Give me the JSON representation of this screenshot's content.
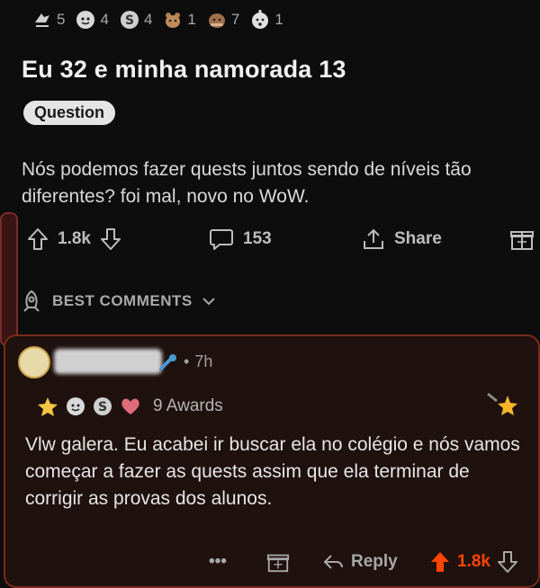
{
  "post_awards": [
    {
      "icon": "helpful-award-icon",
      "count": "5"
    },
    {
      "icon": "wholesome-award-icon",
      "count": "4"
    },
    {
      "icon": "silver-award-icon",
      "count": "4"
    },
    {
      "icon": "bear-award-icon",
      "count": "1"
    },
    {
      "icon": "hug-award-icon",
      "count": "7"
    },
    {
      "icon": "wow-award-icon",
      "count": "1"
    }
  ],
  "post": {
    "title": "Eu 32 e minha namorada 13",
    "flair": "Question",
    "body": "Nós podemos fazer quests juntos sendo de níveis tão diferentes? foi mal, novo no WoW.",
    "upvotes": "1.8k",
    "comments": "153",
    "share_label": "Share"
  },
  "comments_sort": {
    "label": "BEST COMMENTS"
  },
  "comment": {
    "time": "7h",
    "awards_label": "9 Awards",
    "body": "Vlw galera. Eu acabei ir buscar ela no colégio e nós vamos começar a fazer as quests assim que ela terminar de corrigir as provas dos alunos.",
    "more_label": "•••",
    "reply_label": "Reply",
    "upvotes": "1.8k"
  },
  "colors": {
    "upvote": "#ff4500",
    "comment_border": "#7a2a1a"
  }
}
